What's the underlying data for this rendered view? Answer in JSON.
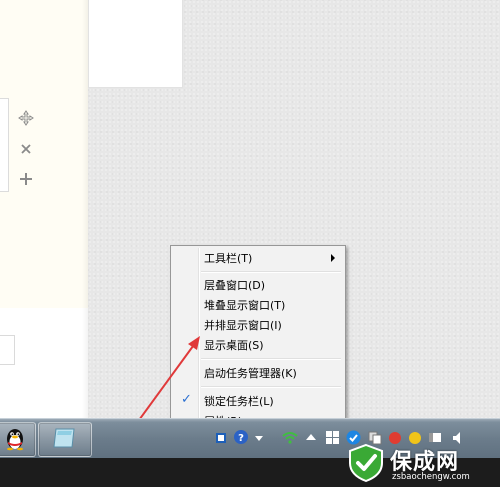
{
  "context_menu": {
    "items": [
      {
        "label": "工具栏(T)",
        "has_submenu": true,
        "checked": false
      },
      {
        "label": "层叠窗口(D)",
        "has_submenu": false,
        "checked": false
      },
      {
        "label": "堆叠显示窗口(T)",
        "has_submenu": false,
        "checked": false
      },
      {
        "label": "并排显示窗口(I)",
        "has_submenu": false,
        "checked": false
      },
      {
        "label": "显示桌面(S)",
        "has_submenu": false,
        "checked": false
      },
      {
        "label": "启动任务管理器(K)",
        "has_submenu": false,
        "checked": false
      },
      {
        "label": "锁定任务栏(L)",
        "has_submenu": false,
        "checked": true
      },
      {
        "label": "属性(R)",
        "has_submenu": false,
        "checked": false
      }
    ],
    "check_glyph": "✓"
  },
  "left_pane": {
    "icons": [
      "move-icon",
      "close-icon",
      "plus-icon"
    ]
  },
  "taskbar": {
    "buttons": [
      "qq-penguin-icon",
      "notepad-window-icon"
    ],
    "tray_icons": [
      "network-icon",
      "help-icon",
      "dropdown-icon",
      "wifi-signal-icon",
      "show-hidden-icons-icon",
      "windows-flag-icon",
      "security-check-icon",
      "copy-icon",
      "app-icon",
      "app-icon-2",
      "flag-icon",
      "volume-icon"
    ]
  },
  "annotation": {
    "color": "#e0393a"
  },
  "watermark": {
    "title": "保成网",
    "url": "zsbaochengw.com",
    "color": "#3aa935"
  }
}
